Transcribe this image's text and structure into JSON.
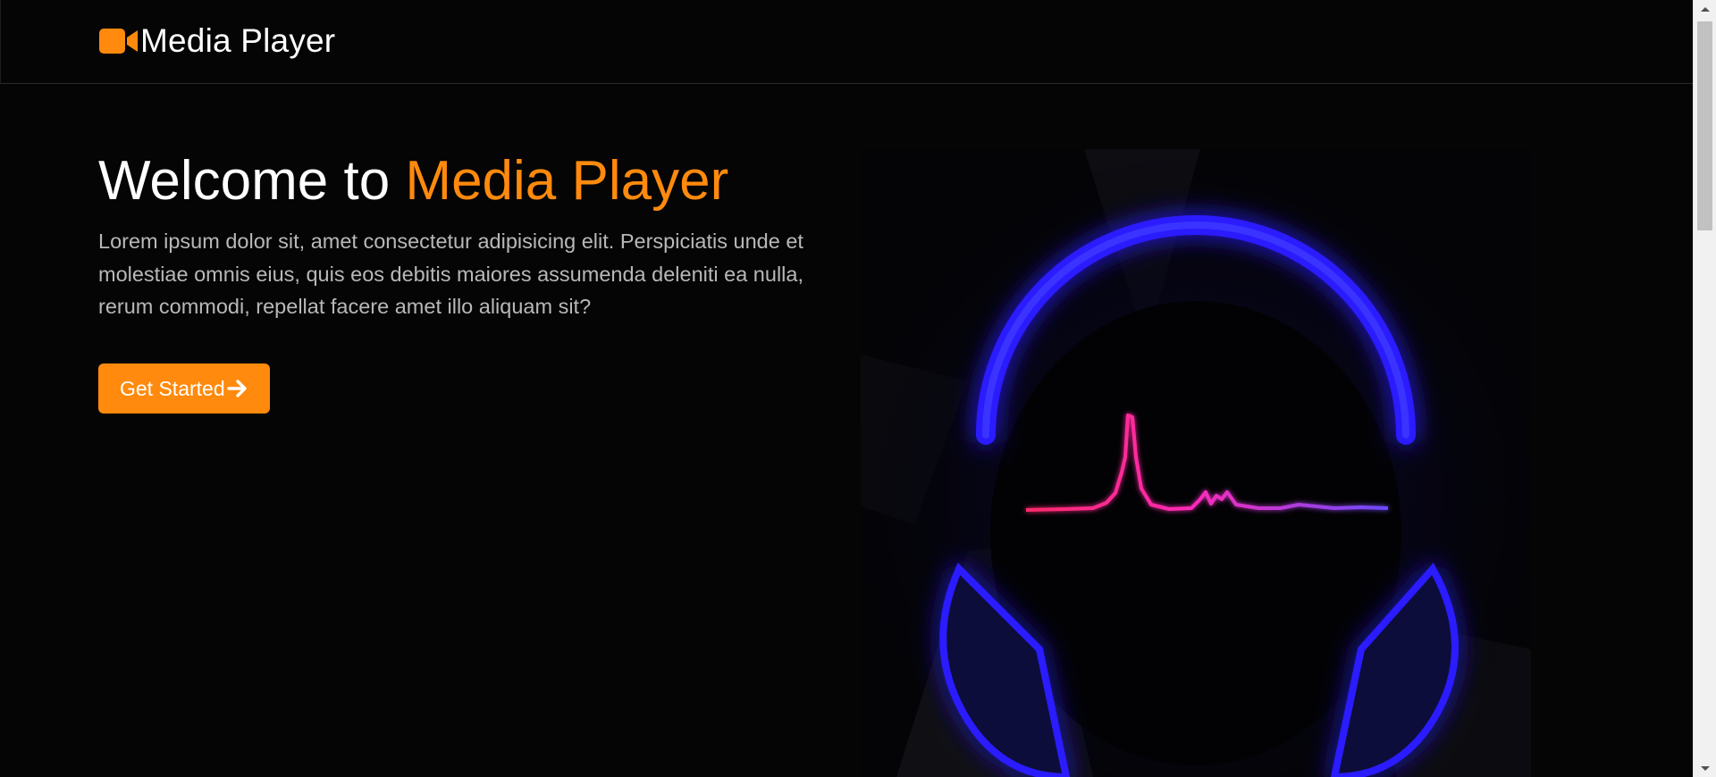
{
  "header": {
    "brand_label": "Media Player",
    "brand_icon": "video-camera-icon"
  },
  "hero": {
    "title_prefix": "Welcome to ",
    "title_accent": "Media Player",
    "description": "Lorem ipsum dolor sit, amet consectetur adipisicing elit. Perspiciatis unde et molestiae omnis eius, quis eos debitis maiores assumenda deleniti ea nulla, rerum commodi, repellat facere amet illo aliquam sit?",
    "cta_label": "Get Started",
    "cta_icon": "arrow-right-icon",
    "image_subject": "headphones-waveform-illustration"
  },
  "colors": {
    "background": "#050505",
    "accent": "#ff8a0d",
    "text": "#ffffff",
    "muted_text": "#b8b8b8",
    "headphone_glow": "#2a1fff",
    "waveform_start": "#ff2a6d",
    "waveform_end": "#6a4bff"
  }
}
